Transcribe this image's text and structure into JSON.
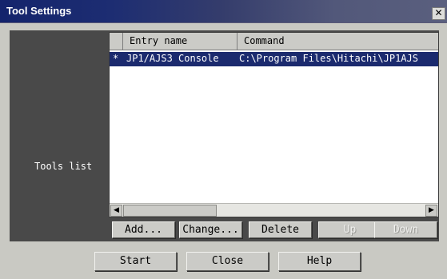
{
  "window": {
    "title": "Tool Settings",
    "close_glyph": "✕"
  },
  "panel": {
    "tools_label": "Tools list"
  },
  "list": {
    "columns": [
      "Entry name",
      "Command"
    ],
    "rows": [
      {
        "marker": "*",
        "entry": "JP1/AJS3 Console",
        "command": "C:\\Program Files\\Hitachi\\JP1AJS"
      }
    ]
  },
  "scrollbar": {
    "left_arrow": "◀",
    "right_arrow": "▶"
  },
  "list_buttons": {
    "add": "Add...",
    "change": "Change...",
    "delete": "Delete",
    "up": "Up",
    "down": "Down"
  },
  "dialog_buttons": {
    "start": "Start",
    "close": "Close",
    "help": "Help"
  },
  "colors": {
    "title_bar_start": "#14246c",
    "selection": "#1b2a6e",
    "panel": "#494949",
    "face": "#c9c9c3"
  }
}
